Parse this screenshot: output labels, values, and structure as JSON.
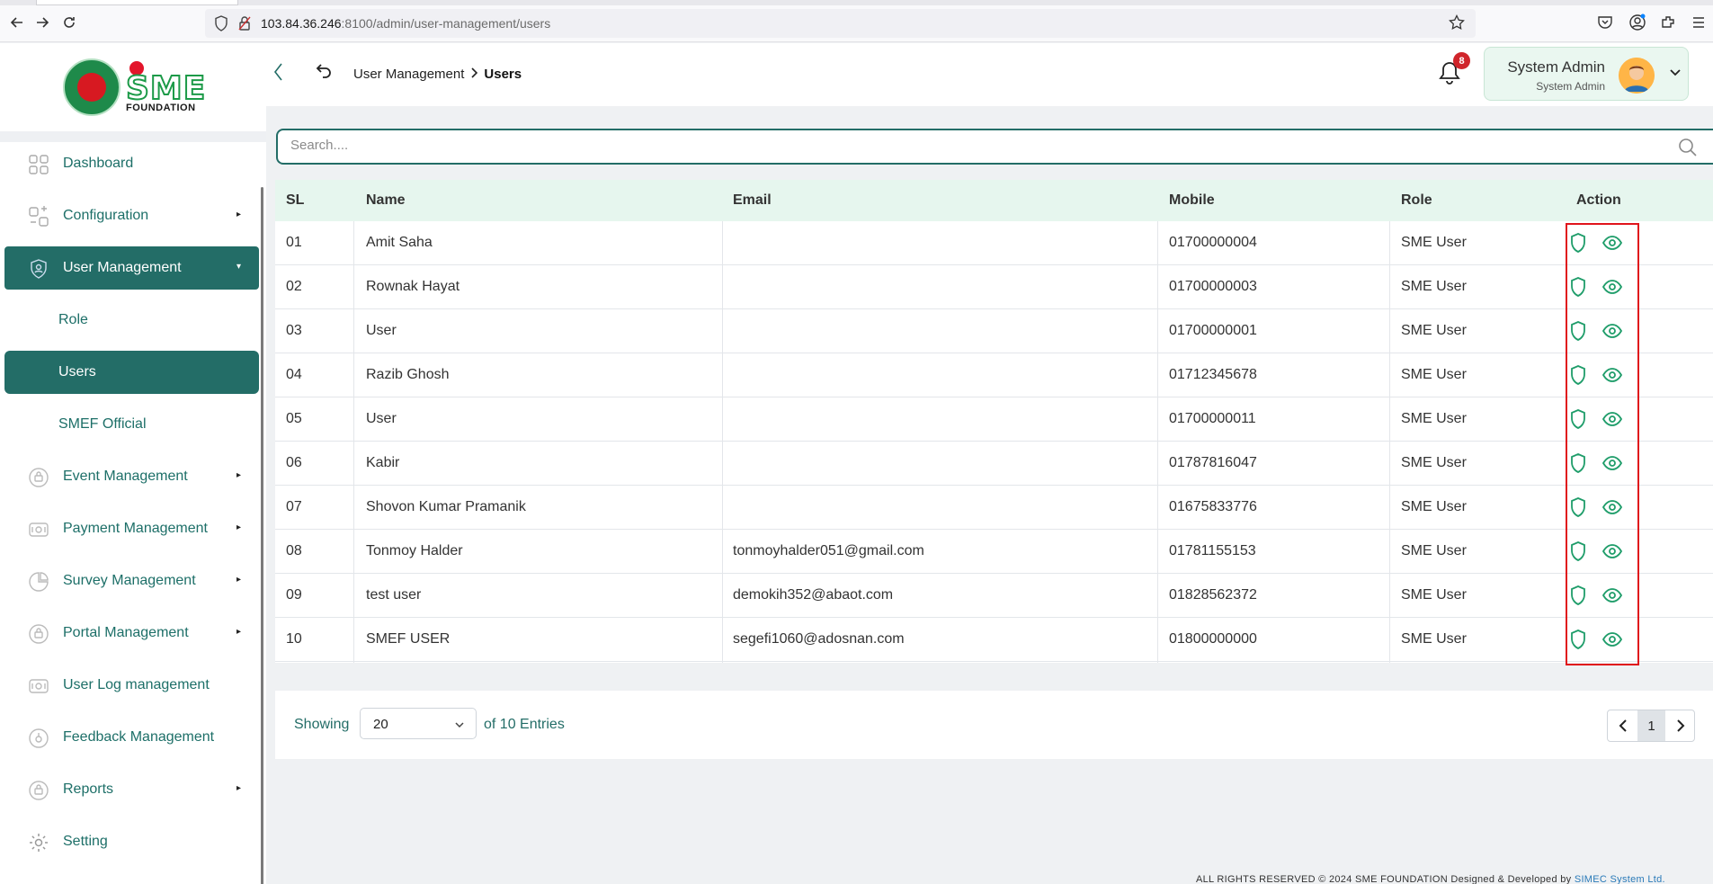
{
  "browser": {
    "url_host": "103.84.36.246",
    "url_path": ":8100/admin/user-management/users"
  },
  "brand": {
    "logo_text": "SME",
    "foundation": "FOUNDATION"
  },
  "sidebar": {
    "items": [
      {
        "label": "Dashboard",
        "icon": "dashboard-icon"
      },
      {
        "label": "Configuration",
        "icon": "configuration-icon"
      },
      {
        "label": "User Management",
        "icon": "user-management-icon"
      },
      {
        "label": "Role"
      },
      {
        "label": "Users"
      },
      {
        "label": "SMEF Official"
      },
      {
        "label": "Event Management",
        "icon": "event-icon"
      },
      {
        "label": "Payment Management",
        "icon": "payment-icon"
      },
      {
        "label": "Survey Management",
        "icon": "survey-icon"
      },
      {
        "label": "Portal Management",
        "icon": "portal-icon"
      },
      {
        "label": "User Log management",
        "icon": "log-icon"
      },
      {
        "label": "Feedback Management",
        "icon": "feedback-icon"
      },
      {
        "label": "Reports",
        "icon": "reports-icon"
      },
      {
        "label": "Setting",
        "icon": "gear-icon"
      }
    ]
  },
  "header": {
    "breadcrumb_parent": "User Management",
    "breadcrumb_current": "Users",
    "notification_count": "8",
    "user_name": "System Admin",
    "user_role": "System Admin"
  },
  "search": {
    "placeholder": "Search...."
  },
  "table": {
    "columns": [
      "SL",
      "Name",
      "Email",
      "Mobile",
      "Role",
      "Action"
    ],
    "rows": [
      {
        "sl": "01",
        "name": "Amit Saha",
        "email": "",
        "mobile": "01700000004",
        "role": "SME User"
      },
      {
        "sl": "02",
        "name": "Rownak Hayat",
        "email": "",
        "mobile": "01700000003",
        "role": "SME User"
      },
      {
        "sl": "03",
        "name": "User",
        "email": "",
        "mobile": "01700000001",
        "role": "SME User"
      },
      {
        "sl": "04",
        "name": "Razib Ghosh",
        "email": "",
        "mobile": "01712345678",
        "role": "SME User"
      },
      {
        "sl": "05",
        "name": "User",
        "email": "",
        "mobile": "01700000011",
        "role": "SME User"
      },
      {
        "sl": "06",
        "name": "Kabir",
        "email": "",
        "mobile": "01787816047",
        "role": "SME User"
      },
      {
        "sl": "07",
        "name": "Shovon Kumar Pramanik",
        "email": "",
        "mobile": "01675833776",
        "role": "SME User"
      },
      {
        "sl": "08",
        "name": "Tonmoy Halder",
        "email": "tonmoyhalder051@gmail.com",
        "mobile": "01781155153",
        "role": "SME User"
      },
      {
        "sl": "09",
        "name": "test user",
        "email": "demokih352@abaot.com",
        "mobile": "01828562372",
        "role": "SME User"
      },
      {
        "sl": "10",
        "name": "SMEF USER",
        "email": "segefi1060@adosnan.com",
        "mobile": "01800000000",
        "role": "SME User"
      }
    ]
  },
  "pagination": {
    "showing_label": "Showing",
    "page_size": "20",
    "entries_label": "of 10 Entries",
    "current_page": "1"
  },
  "footer": {
    "copyright": "ALL RIGHTS RESERVED © 2024 SME FOUNDATION",
    "developed_by": "Designed & Developed by",
    "developer": "SIMEC System Ltd."
  },
  "colors": {
    "primary": "#236d67",
    "accent_green": "#1f9d6a",
    "header_row": "#e6f6ee",
    "highlight": "#e0141c"
  }
}
